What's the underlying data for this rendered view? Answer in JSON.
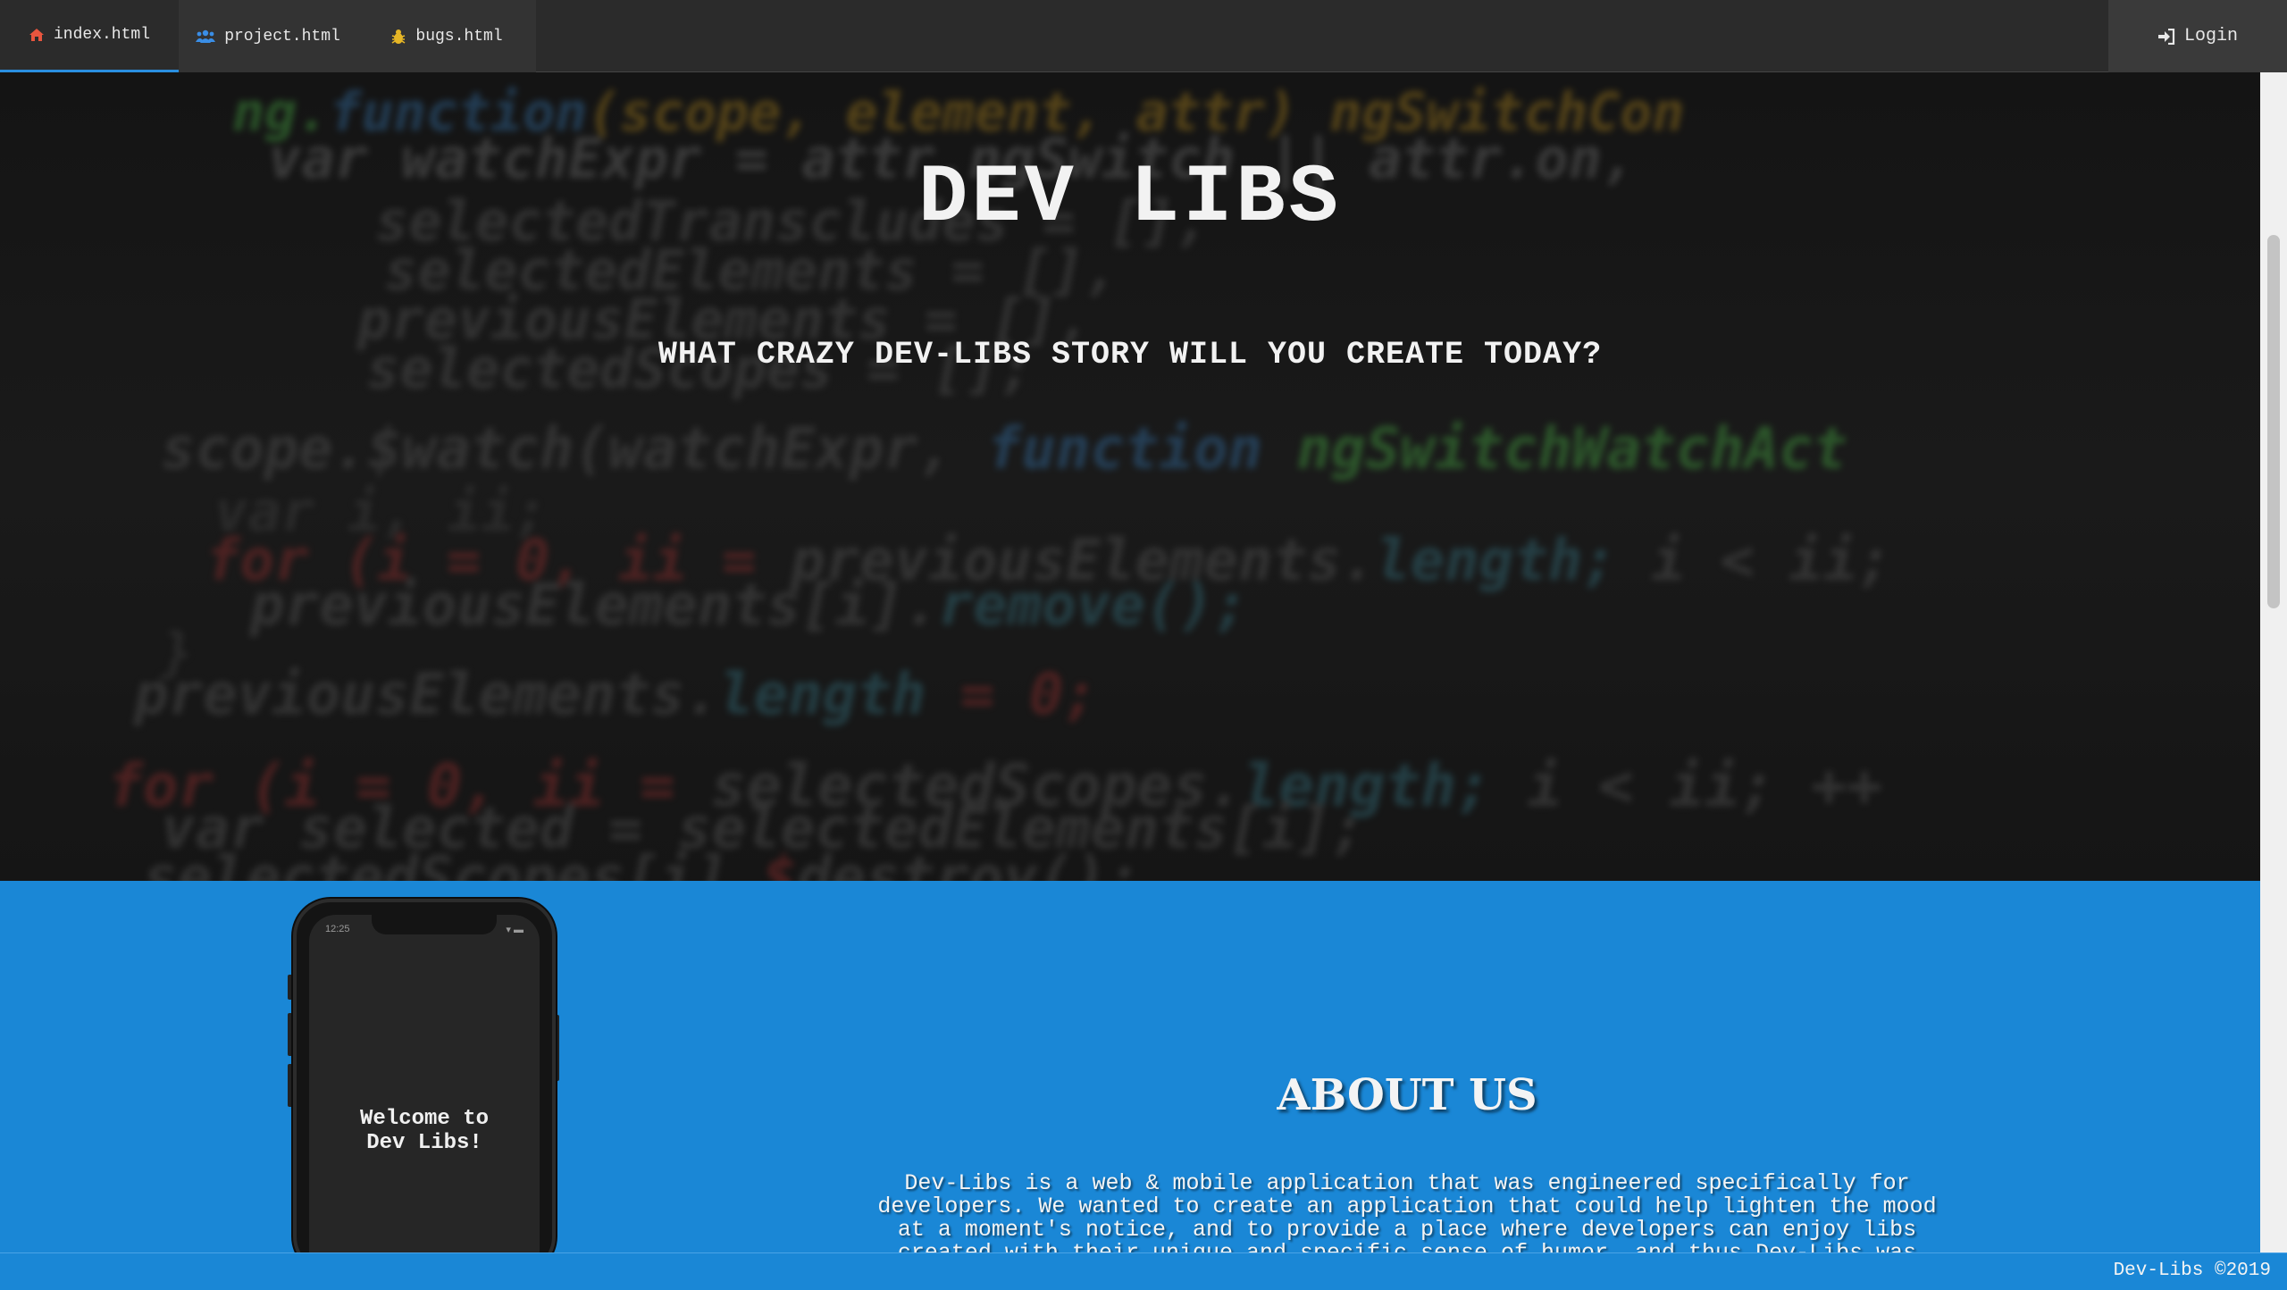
{
  "nav": {
    "tabs": [
      {
        "label": "index.html",
        "icon": "home-icon",
        "icon_color": "#e8553e",
        "active": true
      },
      {
        "label": "project.html",
        "icon": "users-icon",
        "icon_color": "#3a8ee6",
        "active": false
      },
      {
        "label": "bugs.html",
        "icon": "bug-icon",
        "icon_color": "#e6b626",
        "active": false
      }
    ],
    "login_label": "Login",
    "login_icon": "sign-in-icon"
  },
  "hero": {
    "title": "DEV LIBS",
    "subtitle": "WHAT CRAZY DEV-LIBS STORY WILL YOU CREATE TODAY?"
  },
  "about": {
    "phone_time": "12:25",
    "phone_welcome_line1": "Welcome to",
    "phone_welcome_line2": "Dev Libs!",
    "title": "ABOUT US",
    "text": "Dev-Libs is a web & mobile application that was engineered specifically for developers. We wanted to create an application that could help lighten the mood at a moment's notice, and to provide a place where developers can enjoy libs created with their unique and specific sense of humor, and thus Dev-Libs was created."
  },
  "footer": {
    "text": "Dev-Libs ©2019"
  },
  "colors": {
    "accent": "#1a87d6",
    "active_tab_underline": "#2a8fe0",
    "nav_bg": "#2b2b2b"
  }
}
